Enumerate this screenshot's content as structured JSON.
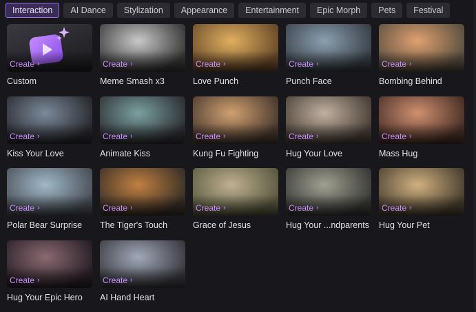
{
  "tabs": [
    {
      "label": "Interaction",
      "active": true
    },
    {
      "label": "AI Dance",
      "active": false
    },
    {
      "label": "Stylization",
      "active": false
    },
    {
      "label": "Appearance",
      "active": false
    },
    {
      "label": "Entertainment",
      "active": false
    },
    {
      "label": "Epic Morph",
      "active": false
    },
    {
      "label": "Pets",
      "active": false
    },
    {
      "label": "Festival",
      "active": false
    }
  ],
  "create_label": "Create",
  "cards": [
    {
      "title": "Custom",
      "icon": "video-sparkle-icon",
      "colors": [
        "#3a3a40",
        "#1d1d21"
      ]
    },
    {
      "title": "Meme Smash x3",
      "colors": [
        "#c9c9c9",
        "#3a3a3a"
      ]
    },
    {
      "title": "Love Punch",
      "colors": [
        "#e0b060",
        "#6a4a2a"
      ]
    },
    {
      "title": "Punch Face",
      "colors": [
        "#8aa0b0",
        "#3a4048"
      ]
    },
    {
      "title": "Bombing Behind",
      "colors": [
        "#e0a070",
        "#5a5040"
      ]
    },
    {
      "title": "Kiss Your Love",
      "colors": [
        "#7a8a9a",
        "#2a2a30"
      ]
    },
    {
      "title": "Animate Kiss",
      "colors": [
        "#7aa0a0",
        "#2e3034"
      ]
    },
    {
      "title": "Kung Fu Fighting",
      "colors": [
        "#d0a070",
        "#4a3a30"
      ]
    },
    {
      "title": "Hug Your Love",
      "colors": [
        "#c0b0a0",
        "#4a4038"
      ]
    },
    {
      "title": "Mass Hug",
      "colors": [
        "#d09070",
        "#4a3028"
      ]
    },
    {
      "title": "Polar Bear Surprise",
      "colors": [
        "#a0b8c8",
        "#4a5058"
      ]
    },
    {
      "title": "The Tiger's Touch",
      "colors": [
        "#c08040",
        "#3a3028"
      ]
    },
    {
      "title": "Grace of Jesus",
      "colors": [
        "#c0b090",
        "#5a5a40"
      ]
    },
    {
      "title": "Hug Your ...ndparents",
      "colors": [
        "#a0a090",
        "#3a3a38"
      ]
    },
    {
      "title": "Hug Your Pet",
      "colors": [
        "#d0b080",
        "#4a4030"
      ]
    },
    {
      "title": "Hug Your Epic Hero",
      "colors": [
        "#8a6a70",
        "#2a2028"
      ]
    },
    {
      "title": "AI Hand Heart",
      "colors": [
        "#a0a8b8",
        "#3a3a40"
      ]
    }
  ]
}
